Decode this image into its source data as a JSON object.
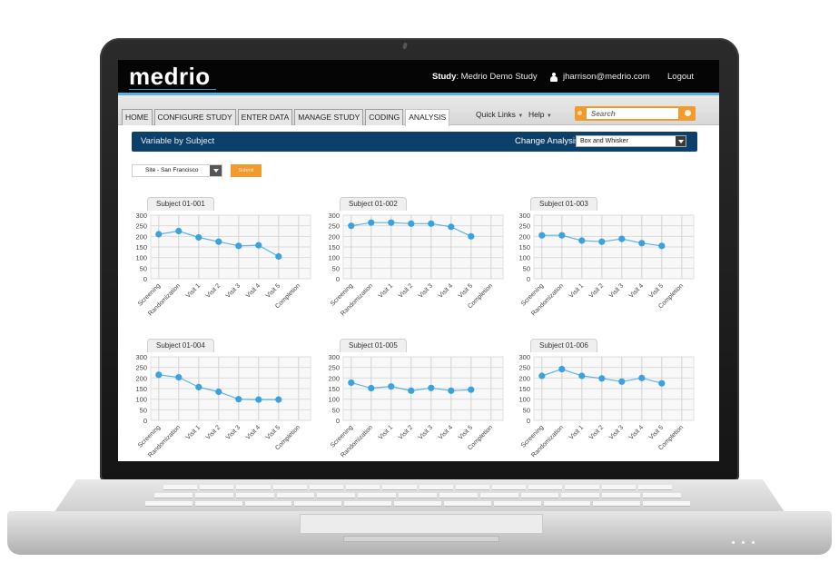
{
  "app": {
    "logo": "medrio",
    "study_label": "Study",
    "study_name": ": Medrio Demo Study",
    "user_email": "jharrison@medrio.com",
    "logout_label": "Logout"
  },
  "nav": {
    "tabs": [
      {
        "label": "HOME",
        "active": false
      },
      {
        "label": "CONFIGURE STUDY",
        "active": false
      },
      {
        "label": "ENTER DATA",
        "active": false
      },
      {
        "label": "MANAGE STUDY",
        "active": false
      },
      {
        "label": "CODING",
        "active": false
      },
      {
        "label": "ANALYSIS",
        "active": true
      }
    ],
    "quick_links_label": "Quick Links",
    "help_label": "Help",
    "search_placeholder": "Search"
  },
  "analysis": {
    "title": "Variable by Subject",
    "change_label": "Change Analysis",
    "selected_analysis": "Box and Whisker",
    "site_selected": "Site - San Francisco",
    "submit_label": "Submit"
  },
  "colors": {
    "accent_orange": "#f39a2c",
    "header_navy": "#0c3f6a",
    "series_blue": "#3aa3df",
    "header_black": "#050505"
  },
  "chart_data": [
    {
      "type": "line",
      "title": "Subject 01-001",
      "categories": [
        "Screening",
        "Randomization",
        "Visit 1",
        "Visit 2",
        "Visit 3",
        "Visit 4",
        "Visit 5",
        "Completion"
      ],
      "values": [
        210,
        225,
        195,
        175,
        155,
        158,
        105,
        null
      ],
      "yticks": [
        0,
        50,
        100,
        150,
        200,
        250,
        300
      ],
      "ylim": [
        0,
        300
      ],
      "grid": true,
      "xlabel": "",
      "ylabel": ""
    },
    {
      "type": "line",
      "title": "Subject 01-002",
      "categories": [
        "Screening",
        "Randomization",
        "Visit 1",
        "Visit 2",
        "Visit 3",
        "Visit 4",
        "Visit 5",
        "Completion"
      ],
      "values": [
        250,
        265,
        265,
        260,
        260,
        245,
        200,
        null
      ],
      "yticks": [
        0,
        50,
        100,
        150,
        200,
        250,
        300
      ],
      "ylim": [
        0,
        300
      ],
      "grid": true,
      "xlabel": "",
      "ylabel": ""
    },
    {
      "type": "line",
      "title": "Subject 01-003",
      "categories": [
        "Screening",
        "Randomization",
        "Visit 1",
        "Visit 2",
        "Visit 3",
        "Visit 4",
        "Visit 5",
        "Completion"
      ],
      "values": [
        205,
        205,
        180,
        175,
        188,
        168,
        155,
        null
      ],
      "yticks": [
        0,
        50,
        100,
        150,
        200,
        250,
        300
      ],
      "ylim": [
        0,
        300
      ],
      "grid": true,
      "xlabel": "",
      "ylabel": ""
    },
    {
      "type": "line",
      "title": "Subject 01-004",
      "categories": [
        "Screening",
        "Randomization",
        "Visit 1",
        "Visit 2",
        "Visit 3",
        "Visit 4",
        "Visit 5",
        "Completion"
      ],
      "values": [
        215,
        203,
        157,
        135,
        100,
        98,
        98,
        null
      ],
      "yticks": [
        0,
        50,
        100,
        150,
        200,
        250,
        300
      ],
      "ylim": [
        0,
        300
      ],
      "grid": true,
      "xlabel": "",
      "ylabel": ""
    },
    {
      "type": "line",
      "title": "Subject 01-005",
      "categories": [
        "Screening",
        "Randomization",
        "Visit 1",
        "Visit 2",
        "Visit 3",
        "Visit 4",
        "Visit 5",
        "Completion"
      ],
      "values": [
        178,
        152,
        160,
        140,
        153,
        140,
        145,
        null
      ],
      "yticks": [
        0,
        50,
        100,
        150,
        200,
        250,
        300
      ],
      "ylim": [
        0,
        300
      ],
      "grid": true,
      "xlabel": "",
      "ylabel": ""
    },
    {
      "type": "line",
      "title": "Subject 01-006",
      "categories": [
        "Screening",
        "Randomization",
        "Visit 1",
        "Visit 2",
        "Visit 3",
        "Visit 4",
        "Visit 5",
        "Completion"
      ],
      "values": [
        210,
        242,
        210,
        198,
        183,
        200,
        175,
        null
      ],
      "yticks": [
        0,
        50,
        100,
        150,
        200,
        250,
        300
      ],
      "ylim": [
        0,
        300
      ],
      "grid": true,
      "xlabel": "",
      "ylabel": ""
    }
  ]
}
